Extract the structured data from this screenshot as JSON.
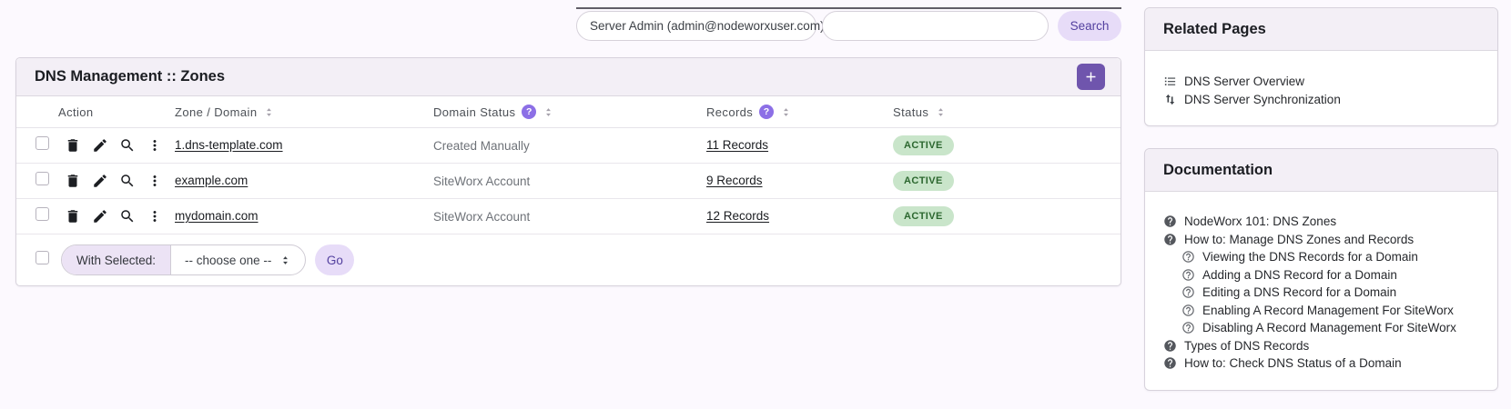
{
  "topbar": {
    "account_select_value": "Server Admin (admin@nodeworxuser.com)",
    "search_value": "",
    "search_button_label": "Search"
  },
  "main": {
    "title": "DNS Management :: Zones",
    "add_button_icon": "plus-icon",
    "table": {
      "headers": {
        "action": "Action",
        "zone": "Zone / Domain",
        "domain_status": "Domain Status",
        "records": "Records",
        "status": "Status"
      },
      "action_icons": [
        "trash-icon",
        "pencil-icon",
        "search-icon",
        "kebab-menu-icon"
      ],
      "rows": [
        {
          "zone": "1.dns-template.com",
          "domain_status": "Created Manually",
          "records": "11 Records",
          "status": "ACTIVE"
        },
        {
          "zone": "example.com",
          "domain_status": "SiteWorx Account",
          "records": "9 Records",
          "status": "ACTIVE"
        },
        {
          "zone": "mydomain.com",
          "domain_status": "SiteWorx Account",
          "records": "12 Records",
          "status": "ACTIVE"
        }
      ],
      "footer": {
        "with_selected_label": "With Selected:",
        "bulk_select_value": "-- choose one --",
        "go_label": "Go"
      }
    }
  },
  "sidebar": {
    "related_pages": {
      "title": "Related Pages",
      "items": [
        {
          "label": "DNS Server Overview",
          "icon": "list-icon"
        },
        {
          "label": "DNS Server Synchronization",
          "icon": "sync-arrows-icon"
        }
      ]
    },
    "documentation": {
      "title": "Documentation",
      "items": [
        {
          "label": "NodeWorx 101: DNS Zones",
          "icon": "help-filled-icon",
          "level": 0
        },
        {
          "label": "How to: Manage DNS Zones and Records",
          "icon": "help-filled-icon",
          "level": 0
        },
        {
          "label": "Viewing the DNS Records for a Domain",
          "icon": "help-outline-icon",
          "level": 1
        },
        {
          "label": "Adding a DNS Record for a Domain",
          "icon": "help-outline-icon",
          "level": 1
        },
        {
          "label": "Editing a DNS Record for a Domain",
          "icon": "help-outline-icon",
          "level": 1
        },
        {
          "label": "Enabling A Record Management For SiteWorx",
          "icon": "help-outline-icon",
          "level": 1
        },
        {
          "label": "Disabling A Record Management For SiteWorx",
          "icon": "help-outline-icon",
          "level": 1
        },
        {
          "label": "Types of DNS Records",
          "icon": "help-filled-icon",
          "level": 0
        },
        {
          "label": "How to: Check DNS Status of a Domain",
          "icon": "help-filled-icon",
          "level": 0
        }
      ]
    }
  },
  "colors": {
    "page_bg": "#fcf9fe",
    "panel_header_bg": "#f3eff6",
    "accent_purple": "#6f55ad",
    "light_purple_button_bg": "#e7dcf8",
    "light_purple_button_text": "#53409f",
    "badge_green_bg": "#c9e5ca",
    "badge_green_text": "#2c672f",
    "help_badge_purple": "#8c6fe6"
  }
}
